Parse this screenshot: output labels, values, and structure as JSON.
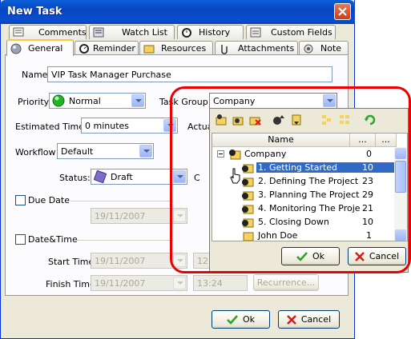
{
  "window": {
    "title": "New Task"
  },
  "tabs_row1": [
    {
      "label": "Comments",
      "icon": "comments-icon"
    },
    {
      "label": "Watch List",
      "icon": "watch-list-icon"
    },
    {
      "label": "History",
      "icon": "history-icon"
    },
    {
      "label": "Custom Fields",
      "icon": "custom-fields-icon"
    }
  ],
  "tabs_row2": [
    {
      "label": "General",
      "icon": "general-icon"
    },
    {
      "label": "Reminder",
      "icon": "reminder-icon"
    },
    {
      "label": "Resources",
      "icon": "resources-icon"
    },
    {
      "label": "Attachments",
      "icon": "attachments-icon"
    },
    {
      "label": "Note",
      "icon": "note-icon"
    }
  ],
  "form": {
    "name_label": "Name:",
    "name_value": "VIP Task Manager Purchase",
    "priority_label": "Priority:",
    "priority_value": "Normal",
    "task_group_label": "Task Group:",
    "task_group_value": "Company",
    "estimated_label": "Estimated Time:",
    "estimated_value": "0 minutes",
    "actual_label": "Actua",
    "workflow_label": "Workflow",
    "workflow_value": "Default",
    "status_label": "Status:",
    "status_value": "Draft",
    "status_right": "C",
    "due_date_label": "Due Date",
    "due_date_value": "19/11/2007",
    "datetime_label": "Date&Time",
    "start_label": "Start Time:",
    "start_date": "19/11/2007",
    "start_time": "12",
    "finish_label": "Finish Time:",
    "finish_date": "19/11/2007",
    "finish_time": "13:24",
    "recurrence_label": "Recurrence..."
  },
  "footer": {
    "ok": "Ok",
    "cancel": "Cancel"
  },
  "popup": {
    "col_name": "Name",
    "col_a": "...",
    "col_b": "...",
    "rows": [
      {
        "label": "Company",
        "value": "0"
      },
      {
        "label": "1. Getting Started",
        "value": "10"
      },
      {
        "label": "2. Defining The Project",
        "value": "23"
      },
      {
        "label": "3. Planning The Project",
        "value": "29"
      },
      {
        "label": "4. Monitoring The Proje",
        "value": "21"
      },
      {
        "label": "5. Closing Down",
        "value": "10"
      },
      {
        "label": "John Doe",
        "value": "1"
      }
    ],
    "ok": "Ok",
    "cancel": "Cancel"
  },
  "colors": {
    "accent": "#316ac5",
    "highlight_ring": "#e00000",
    "title_bar": "#0a4fd0"
  }
}
